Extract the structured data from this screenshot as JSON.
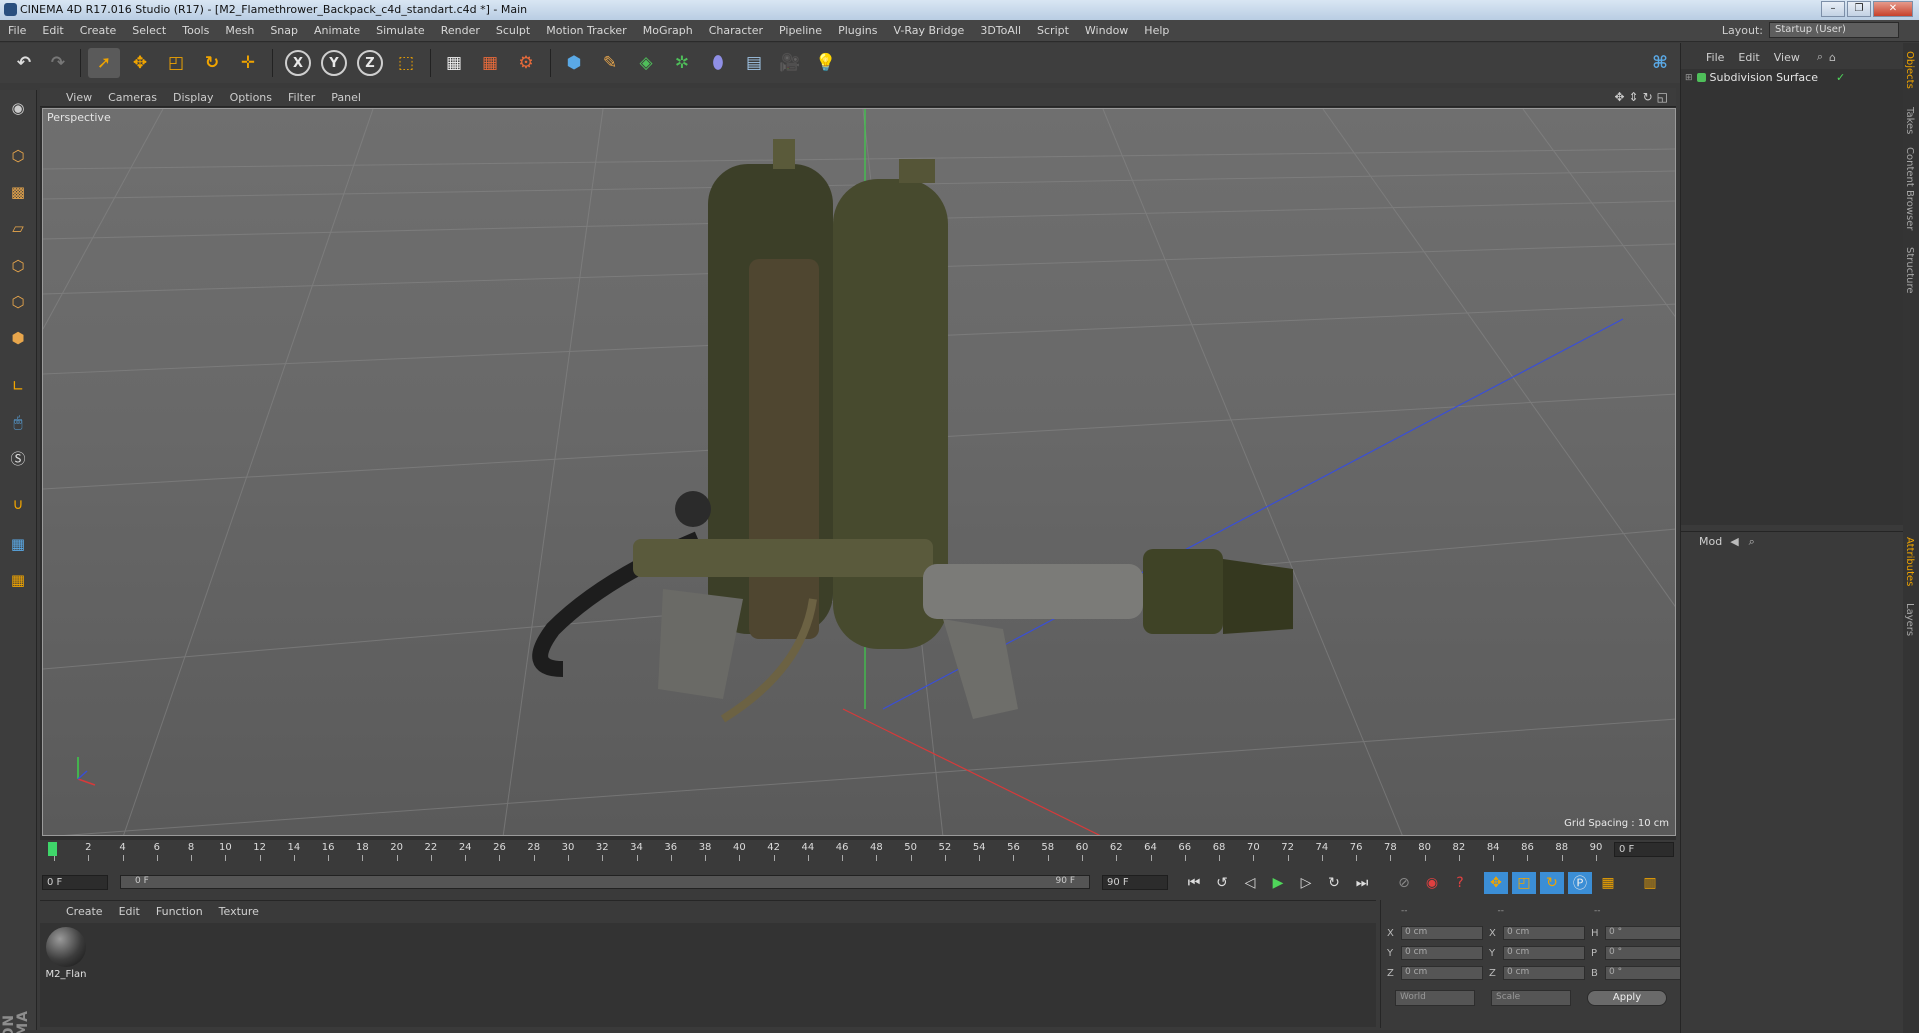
{
  "window": {
    "title": "CINEMA 4D R17.016 Studio (R17) - [M2_Flamethrower_Backpack_c4d_standart.c4d *] - Main",
    "minimize": "–",
    "maximize": "❐",
    "close": "✕"
  },
  "menubar": {
    "items": [
      "File",
      "Edit",
      "Create",
      "Select",
      "Tools",
      "Mesh",
      "Snap",
      "Animate",
      "Simulate",
      "Render",
      "Sculpt",
      "Motion Tracker",
      "MoGraph",
      "Character",
      "Pipeline",
      "Plugins",
      "V-Ray Bridge",
      "3DToAll",
      "Script",
      "Window",
      "Help"
    ],
    "layout_label": "Layout:",
    "layout_value": "Startup (User)"
  },
  "toolbar": {
    "x": "X",
    "y": "Y",
    "z": "Z"
  },
  "viewport": {
    "menu": [
      "View",
      "Cameras",
      "Display",
      "Options",
      "Filter",
      "Panel"
    ],
    "label": "Perspective",
    "grid_spacing": "Grid Spacing : 10 cm",
    "axis_y": "Y",
    "axis_x": "X",
    "axis_z": "Z"
  },
  "timeline": {
    "ticks": [
      "0",
      "2",
      "4",
      "6",
      "8",
      "10",
      "12",
      "14",
      "16",
      "18",
      "20",
      "22",
      "24",
      "26",
      "28",
      "30",
      "32",
      "34",
      "36",
      "38",
      "40",
      "42",
      "44",
      "46",
      "48",
      "50",
      "52",
      "54",
      "56",
      "58",
      "60",
      "62",
      "64",
      "66",
      "68",
      "70",
      "72",
      "74",
      "76",
      "78",
      "80",
      "82",
      "84",
      "86",
      "88",
      "90"
    ],
    "current_frame": "0 F",
    "start_frame": "0 F",
    "range_start": "0 F",
    "range_end": "90 F",
    "end_frame": "90 F"
  },
  "materials": {
    "menu": [
      "Create",
      "Edit",
      "Function",
      "Texture"
    ],
    "items": [
      {
        "name": "M2_Flan"
      }
    ]
  },
  "coordinates": {
    "headers": [
      "--",
      "--",
      "--"
    ],
    "rows": [
      {
        "a": "X",
        "av": "0 cm",
        "b": "X",
        "bv": "0 cm",
        "c": "H",
        "cv": "0 °"
      },
      {
        "a": "Y",
        "av": "0 cm",
        "b": "Y",
        "bv": "0 cm",
        "c": "P",
        "cv": "0 °"
      },
      {
        "a": "Z",
        "av": "0 cm",
        "b": "Z",
        "bv": "0 cm",
        "c": "B",
        "cv": "0 °"
      }
    ],
    "space": "World",
    "mode": "Scale",
    "apply": "Apply"
  },
  "objects": {
    "menu": [
      "File",
      "Edit",
      "View"
    ],
    "items": [
      {
        "name": "Subdivision Surface"
      }
    ]
  },
  "attributes": {
    "mode": "Mod"
  },
  "side_tabs": [
    "Objects",
    "Takes",
    "Content Browser",
    "Structure",
    "Attributes",
    "Layers"
  ],
  "branding": "MAXON CINEMA 4D",
  "colors": {
    "accent": "#f0a400",
    "active_blue": "#3b8ed6",
    "grid_line": "#8a8a8a"
  }
}
